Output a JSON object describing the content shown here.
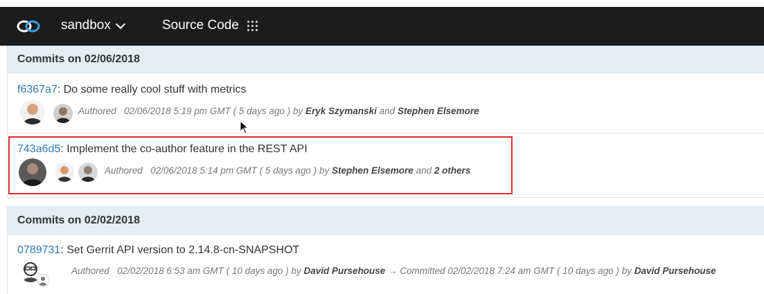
{
  "header": {
    "org_name": "sandbox",
    "app_name": "Source Code",
    "logo_icon": "loop-logo-icon",
    "app_menu_icon": "grid-dots-icon"
  },
  "sections": [
    {
      "heading": "Commits on 02/06/2018",
      "commits": [
        {
          "sha": "f6367a7",
          "message": ": Do some really cool stuff with metrics",
          "verb": "Authored",
          "date": "02/06/2018 5:19 pm GMT",
          "relative": "( 5 days ago )",
          "by": "by",
          "author1": "Eryk Szymanski",
          "and": "and",
          "author2": "Stephen Elsemore"
        },
        {
          "sha": "743a6d5",
          "message": ": Implement the co-author feature in the REST API",
          "verb": "Authored",
          "date": "02/06/2018 5:14 pm GMT",
          "relative": "( 5 days ago )",
          "by": "by",
          "author1": "Stephen Elsemore",
          "and": "and",
          "author2": "2 others"
        }
      ]
    },
    {
      "heading": "Commits on 02/02/2018",
      "commits": [
        {
          "sha": "0789731",
          "message": ": Set Gerrit API version to 2.14.8-cn-SNAPSHOT",
          "verb": "Authored",
          "date": "02/02/2018 6:53 am GMT",
          "relative": "( 10 days ago )",
          "by": "by",
          "author1": "David Pursehouse",
          "arrow": "→",
          "verb2": "Committed",
          "date2": "02/02/2018 7:24 am GMT",
          "relative2": "( 10 days ago )",
          "by2": "by",
          "author2": "David Pursehouse"
        }
      ]
    }
  ],
  "colors": {
    "topbar": "#1c1c1c",
    "section_header": "#e6eef4",
    "sha_link": "#2a7ab8",
    "highlight": "#e02a2a"
  }
}
